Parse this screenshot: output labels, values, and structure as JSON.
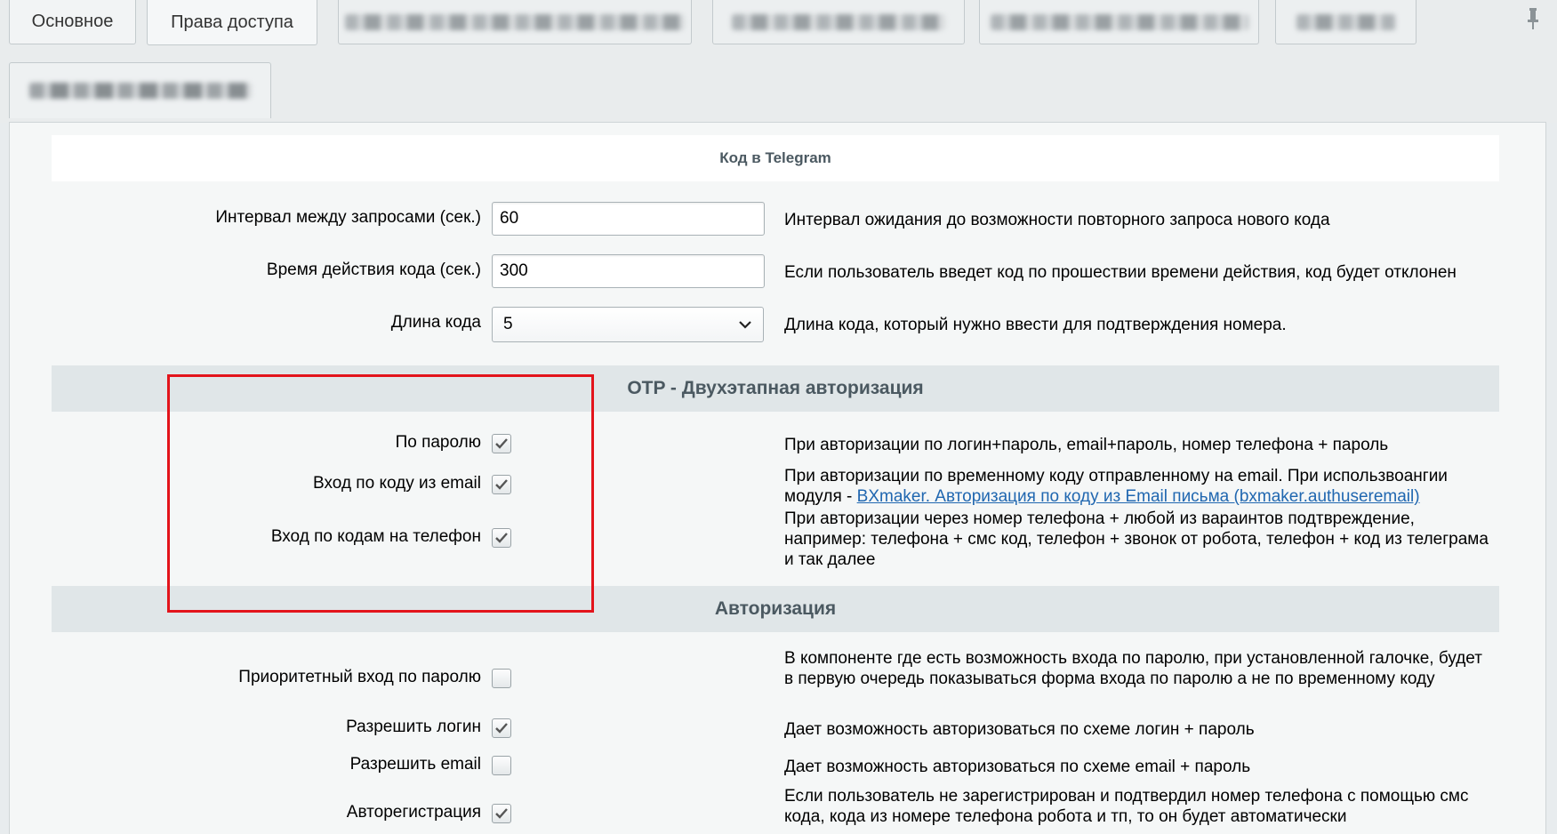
{
  "tabs": [
    {
      "label": "Основное"
    },
    {
      "label": "Права доступа"
    }
  ],
  "sections": {
    "telegram": "Код в Telegram",
    "otp": "OTP - Двухэтапная авторизация",
    "auth": "Авторизация"
  },
  "telegram_fields": {
    "interval_label": "Интервал между запросами (сек.)",
    "interval_value": "60",
    "interval_desc": "Интервал ожидания до возможности повторного запроса нового кода",
    "lifetime_label": "Время действия кода (сек.)",
    "lifetime_value": "300",
    "lifetime_desc": "Если пользователь введет код по прошествии времени действия, код будет отклонен",
    "length_label": "Длина кода",
    "length_value": "5",
    "length_desc": "Длина кода, который нужно ввести для подтверждения номера."
  },
  "otp_fields": {
    "password_label": "По паролю",
    "password_checked": true,
    "password_desc": "При авторизации по логин+пароль, email+пароль, номер телефона + пароль",
    "email_label": "Вход по коду из email",
    "email_checked": true,
    "email_desc_prefix": "При авторизации по временному коду отправленному на email. При использвоангии модуля - ",
    "email_desc_link": "BXmaker. Авторизация по коду из Email письма (bxmaker.authuseremail)",
    "phone_label": "Вход по кодам на телефон",
    "phone_checked": true,
    "phone_desc": "При авторизации через номер телефона + любой из вараинтов подтвреждение, например: телефона + смс код, телефон + звонок от робота, телефон + код из телеграма и так далее"
  },
  "auth_fields": {
    "priority_label": "Приоритетный вход по паролю",
    "priority_checked": false,
    "priority_desc": "В компоненте где есть возможность входа по паролю, при установленной галочке, будет в первую очередь показываться форма входа по паролю а не по временному коду",
    "login_label": "Разрешить логин",
    "login_checked": true,
    "login_desc": "Дает возможность авторизоваться по схеме логин + пароль",
    "email_label": "Разрешить email",
    "email_checked": false,
    "email_desc": "Дает возможность авторизоваться по схеме email + пароль",
    "autoreg_label": "Авторегистрация",
    "autoreg_checked": true,
    "autoreg_desc": "Если пользователь не зарегистрирован и подтвердил номер телефона с помощью смс кода, кода из номере телефона робота и тп, то он будет автоматически"
  },
  "colors": {
    "highlight": "#e3141b",
    "link": "#2067b0",
    "section_bg": "#e0e6e8"
  }
}
